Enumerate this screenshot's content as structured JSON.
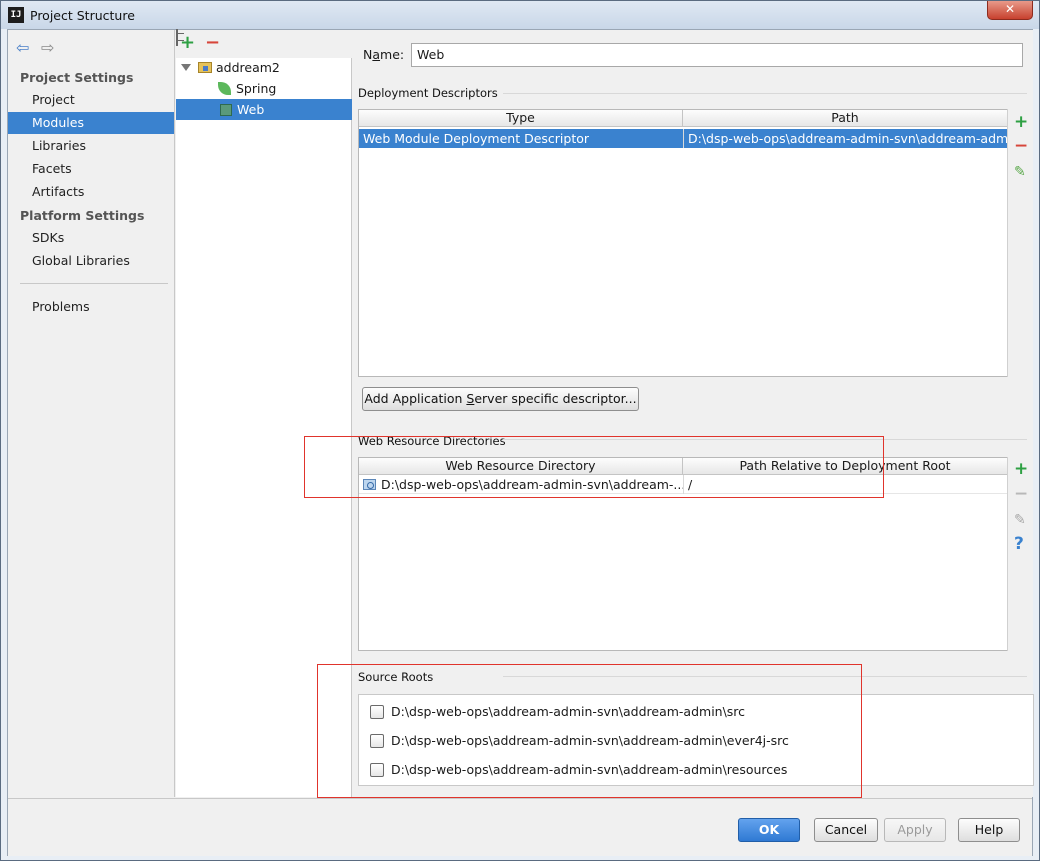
{
  "window": {
    "app_icon": "IJ",
    "title": "Project Structure",
    "close_glyph": "✕"
  },
  "nav": {
    "back_icon": "⇦",
    "forward_icon": "⇨",
    "project_settings_header": "Project Settings",
    "project_settings_items": [
      "Project",
      "Modules",
      "Libraries",
      "Facets",
      "Artifacts"
    ],
    "platform_settings_header": "Platform Settings",
    "platform_settings_items": [
      "SDKs",
      "Global Libraries"
    ],
    "problems": "Problems",
    "selected": "Modules"
  },
  "tree": {
    "toolbar": {
      "add": "+",
      "remove": "−"
    },
    "root": "addream2",
    "children": [
      "Spring",
      "Web"
    ],
    "selected": "Web"
  },
  "main": {
    "name_label": {
      "before": "N",
      "mnemonic": "a",
      "after": "me:"
    },
    "name_value": "Web",
    "deployment_descriptors": {
      "label": "Deployment Descriptors",
      "columns": [
        "Type",
        "Path"
      ],
      "rows": [
        {
          "type": "Web Module Deployment Descriptor",
          "path": "D:\\dsp-web-ops\\addream-admin-svn\\addream-admin\\"
        }
      ],
      "tools": {
        "add": "+",
        "remove": "−",
        "edit": "✎"
      }
    },
    "add_server_button": {
      "before": "Add Application ",
      "mnemonic": "S",
      "after": "erver specific descriptor..."
    },
    "web_resource_directories": {
      "label": "Web Resource Directories",
      "columns": [
        "Web Resource Directory",
        "Path Relative to Deployment Root"
      ],
      "rows": [
        {
          "directory": "D:\\dsp-web-ops\\addream-admin-svn\\addream-...",
          "relative_path": "/"
        }
      ],
      "tools": {
        "add": "+",
        "remove": "−",
        "edit": "✎",
        "help": "?"
      }
    },
    "source_roots": {
      "label": "Source Roots",
      "items": [
        {
          "path": "D:\\dsp-web-ops\\addream-admin-svn\\addream-admin\\src",
          "checked": false
        },
        {
          "path": "D:\\dsp-web-ops\\addream-admin-svn\\addream-admin\\ever4j-src",
          "checked": false
        },
        {
          "path": "D:\\dsp-web-ops\\addream-admin-svn\\addream-admin\\resources",
          "checked": false
        }
      ]
    }
  },
  "buttons": {
    "ok": "OK",
    "cancel": "Cancel",
    "apply": "Apply",
    "help": "Help"
  },
  "colors": {
    "selection": "#3a82cf",
    "highlight_box": "#e0342c",
    "add": "#2ea043",
    "remove": "#d7453a"
  }
}
